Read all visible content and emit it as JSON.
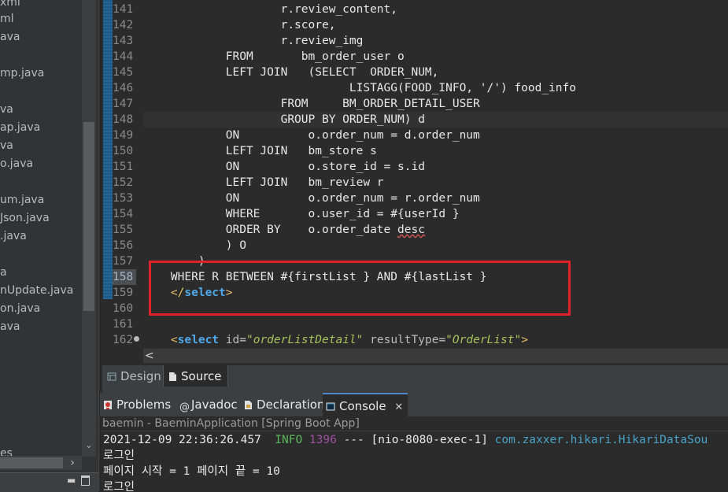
{
  "sidebar": {
    "items": [
      "xml",
      "ml",
      "ava",
      "mp.java",
      "va",
      "ap.java",
      "va",
      "o.java",
      "um.java",
      "Json.java",
      ".java",
      "a",
      "nUpdate.java",
      "on.java",
      "ava",
      "es"
    ]
  },
  "editor": {
    "lines": [
      {
        "n": "141",
        "t": "                    r.review_content,"
      },
      {
        "n": "142",
        "t": "                    r.score,"
      },
      {
        "n": "143",
        "t": "                    r.review_img"
      },
      {
        "n": "144",
        "t": "            FROM       bm_order_user o"
      },
      {
        "n": "145",
        "t": "            LEFT JOIN   (SELECT  ORDER_NUM,"
      },
      {
        "n": "146",
        "t": "                              LISTAGG(FOOD_INFO, '/') food_info"
      },
      {
        "n": "147",
        "t": "                    FROM     BM_ORDER_DETAIL_USER"
      },
      {
        "n": "148",
        "t": "                    GROUP BY ORDER_NUM) d"
      },
      {
        "n": "149",
        "t": "            ON          o.order_num = d.order_num"
      },
      {
        "n": "150",
        "t": "            LEFT JOIN   bm_store s"
      },
      {
        "n": "151",
        "t": "            ON          o.store_id = s.id"
      },
      {
        "n": "152",
        "t": "            LEFT JOIN   bm_review r"
      },
      {
        "n": "153",
        "t": "            ON          o.order_num = r.order_num"
      },
      {
        "n": "154",
        "t": "            WHERE       o.user_id = #{userId }"
      },
      {
        "n": "155",
        "t": "            ORDER BY    o.order_date desc"
      },
      {
        "n": "156",
        "t": "            ) O"
      },
      {
        "n": "157",
        "t": "        )"
      },
      {
        "n": "158",
        "t": "    WHERE R BETWEEN #{firstList } AND #{lastList }"
      },
      {
        "n": "159",
        "t": "    "
      },
      {
        "n": "160",
        "t": ""
      },
      {
        "n": "161",
        "t": ""
      },
      {
        "n": "162",
        "t": "    "
      }
    ],
    "line155_pre": "            ORDER BY    o.order_date ",
    "line155_squig": "desc",
    "line159": {
      "indent": "    ",
      "open": "</",
      "kw": "select",
      "close": ">"
    },
    "line162": {
      "indent": "    ",
      "open": "<",
      "kw": "select",
      "attr1": "id",
      "v1": "\"orderListDetail\"",
      "attr2": "resultType",
      "v2": "\"OrderList\"",
      "close": ">"
    },
    "hscroll_arrow": "<"
  },
  "editor_tabs": {
    "design": "Design",
    "source": "Source"
  },
  "panel": {
    "tabs": {
      "problems": "Problems",
      "javadoc": "Javadoc",
      "declaration": "Declaration",
      "console": "Console"
    },
    "close_glyph": "✕",
    "console_title": "baemin - BaeminApplication [Spring Boot App]",
    "log": {
      "timestamp": "2021-12-09 22:36:26.457",
      "level": "INFO",
      "pid": "1396",
      "sep": "---",
      "thread": "[nio-8080-exec-1]",
      "logger": "com.zaxxer.hikari.HikariDataSou"
    },
    "output": [
      "로그인",
      "페이지 시작 = 1 페이지 끝 = 10",
      "로그인"
    ]
  },
  "colors": {
    "highlight_box": "#e0202a",
    "keyword": "#4fa8e8",
    "string": "#a5c25c",
    "info": "#5cb85c"
  }
}
